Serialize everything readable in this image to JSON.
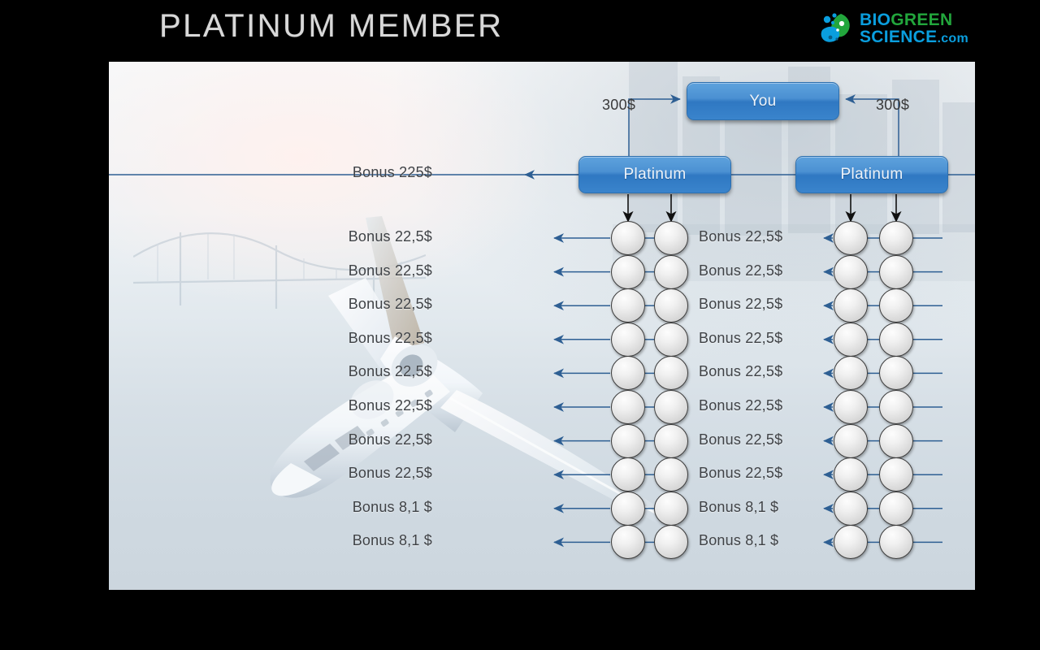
{
  "header": {
    "title": "PLATINUM MEMBER",
    "logo": {
      "icon": "leaf-droplet-icon",
      "line1_part1": "BIO",
      "line1_part2": "GREEN",
      "line2_part1": "SCIENCE",
      "line2_part2": ".com",
      "color_blue": "#0a9ede",
      "color_green": "#22a63c"
    }
  },
  "diagram": {
    "nodes": {
      "you": "You",
      "platinum_left": "Platinum",
      "platinum_right": "Platinum"
    },
    "money_labels": {
      "left": "300$",
      "right": "300$"
    },
    "top_bonus": "Bonus 225$",
    "left_column_bonuses": [
      "Bonus 22,5$",
      "Bonus 22,5$",
      "Bonus 22,5$",
      "Bonus 22,5$",
      "Bonus 22,5$",
      "Bonus 22,5$",
      "Bonus 22,5$",
      "Bonus 22,5$",
      "Bonus 8,1 $",
      "Bonus 8,1 $"
    ],
    "middle_column_bonuses": [
      "Bonus 22,5$",
      "Bonus 22,5$",
      "Bonus 22,5$",
      "Bonus 22,5$",
      "Bonus 22,5$",
      "Bonus 22,5$",
      "Bonus 22,5$",
      "Bonus 22,5$",
      "Bonus 8,1 $",
      "Bonus 8,1 $"
    ],
    "circle_columns": 4,
    "circle_rows": 10,
    "accent_color": "#3a84cc",
    "connector_color": "#2e5f93"
  },
  "background": {
    "image": "private-jet-over-water-photo"
  }
}
